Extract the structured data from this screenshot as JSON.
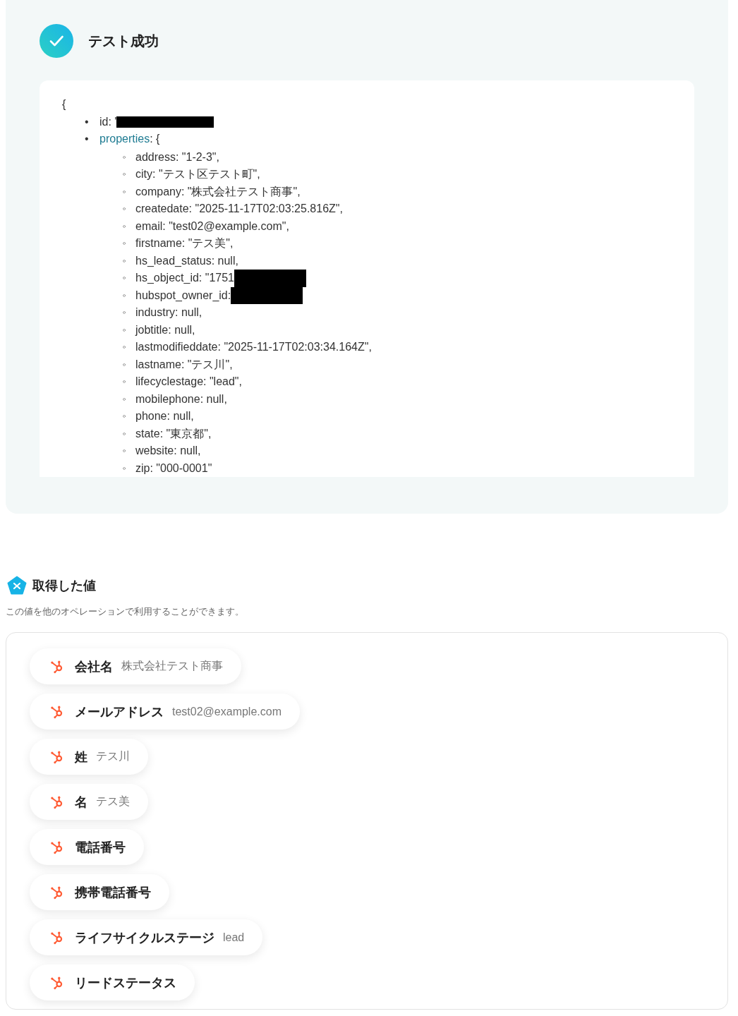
{
  "result": {
    "title": "テスト成功",
    "open_brace": "{",
    "top_items": [
      {
        "marker": "•",
        "key": "id",
        "text": ": '",
        "kind": "plain",
        "redacted": true
      },
      {
        "marker": "•",
        "key": "properties",
        "text": ": {",
        "kind": "link",
        "redacted": false
      }
    ],
    "properties": [
      {
        "marker": "◦",
        "text": "address: \"1-2-3\",",
        "redacted": false
      },
      {
        "marker": "◦",
        "text": "city: \"テスト区テスト町\",",
        "redacted": false
      },
      {
        "marker": "◦",
        "text": "company: \"株式会社テスト商事\",",
        "redacted": false
      },
      {
        "marker": "◦",
        "text": "createdate: \"2025-11-17T02:03:25.816Z\",",
        "redacted": false
      },
      {
        "marker": "◦",
        "text": "email: \"test02@example.com\",",
        "redacted": false
      },
      {
        "marker": "◦",
        "text": "firstname: \"テス美\",",
        "redacted": false
      },
      {
        "marker": "◦",
        "text": "hs_lead_status: null,",
        "redacted": false
      },
      {
        "marker": "◦",
        "text": "hs_object_id: \"1751",
        "redacted": true
      },
      {
        "marker": "◦",
        "text": "hubspot_owner_id:",
        "redacted": true
      },
      {
        "marker": "◦",
        "text": "industry: null,",
        "redacted": false
      },
      {
        "marker": "◦",
        "text": "jobtitle: null,",
        "redacted": false
      },
      {
        "marker": "◦",
        "text": "lastmodifieddate: \"2025-11-17T02:03:34.164Z\",",
        "redacted": false
      },
      {
        "marker": "◦",
        "text": "lastname: \"テス川\",",
        "redacted": false
      },
      {
        "marker": "◦",
        "text": "lifecyclestage: \"lead\",",
        "redacted": false
      },
      {
        "marker": "◦",
        "text": "mobilephone: null,",
        "redacted": false
      },
      {
        "marker": "◦",
        "text": "phone: null,",
        "redacted": false
      },
      {
        "marker": "◦",
        "text": "state: \"東京都\",",
        "redacted": false
      },
      {
        "marker": "◦",
        "text": "website: null,",
        "redacted": false
      },
      {
        "marker": "◦",
        "text": "zip: \"000-0001\"",
        "redacted": false
      }
    ]
  },
  "values": {
    "title": "取得した値",
    "description": "この値を他のオペレーションで利用することができます。",
    "items": [
      {
        "label": "会社名",
        "value": "株式会社テスト商事"
      },
      {
        "label": "メールアドレス",
        "value": "test02@example.com"
      },
      {
        "label": "姓",
        "value": "テス川"
      },
      {
        "label": "名",
        "value": "テス美"
      },
      {
        "label": "電話番号"
      },
      {
        "label": "携帯電話番号"
      },
      {
        "label": "ライフサイクルステージ",
        "value": "lead"
      },
      {
        "label": "リードステータス"
      }
    ]
  }
}
